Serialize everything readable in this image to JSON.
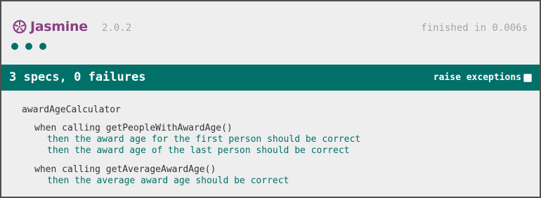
{
  "banner": {
    "title": "Jasmine",
    "version": "2.0.2",
    "duration": "finished in 0.006s",
    "dots_count": 3
  },
  "bar": {
    "message": "3 specs, 0 failures",
    "raise_exceptions_label": "raise exceptions",
    "raise_exceptions_checked": false
  },
  "results": {
    "suite": "awardAgeCalculator",
    "sub_suites": [
      {
        "title": "when calling getPeopleWithAwardAge()",
        "specs": [
          "then the award age for the first person should be correct",
          "then the award age of the last person should be correct"
        ]
      },
      {
        "title": "when calling getAverageAwardAge()",
        "specs": [
          "then the average award age should be correct"
        ]
      }
    ]
  },
  "colors": {
    "brand": "#8a4182",
    "pass": "#007069",
    "bar": "#007069",
    "background": "#eeeeee"
  },
  "icons": {
    "logo": "jasmine-flower-icon",
    "checkbox": "checkbox-icon"
  }
}
